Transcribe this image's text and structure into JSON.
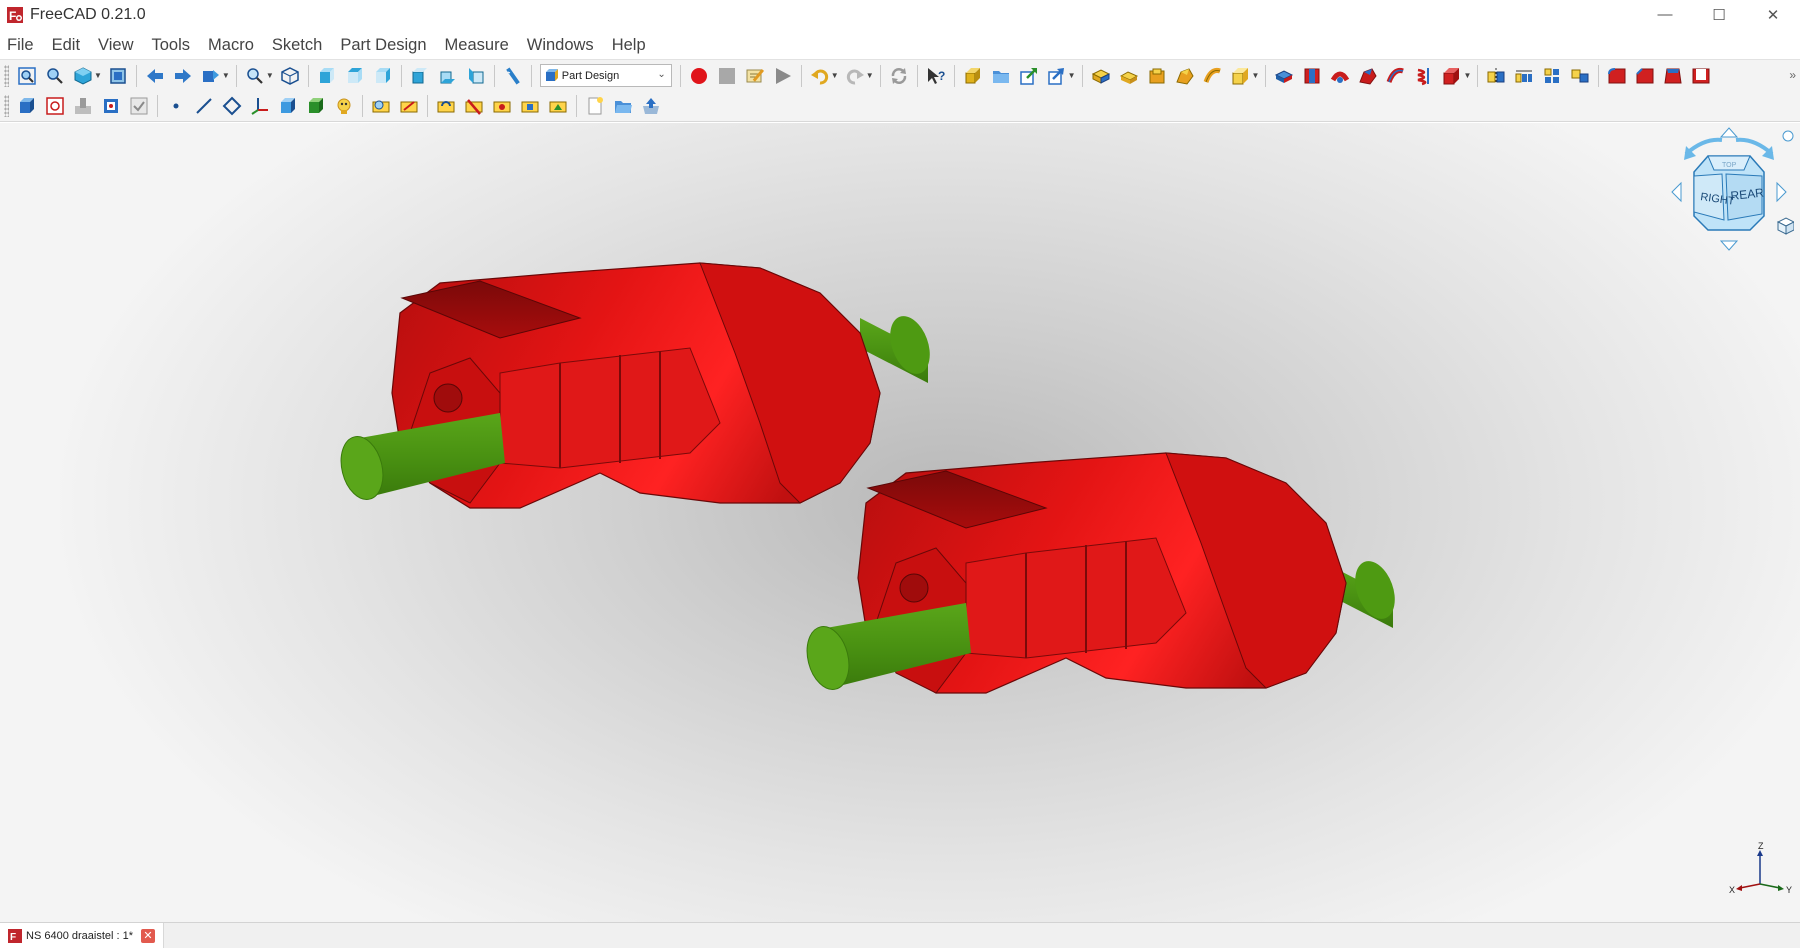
{
  "app": {
    "title": "FreeCAD 0.21.0",
    "logo_icon": "freecad-logo-icon",
    "window_controls": {
      "minimize": "—",
      "maximize": "☐",
      "close": "✕"
    }
  },
  "menu": {
    "items": [
      "File",
      "Edit",
      "View",
      "Tools",
      "Macro",
      "Sketch",
      "Part Design",
      "Measure",
      "Windows",
      "Help"
    ]
  },
  "toolbar": {
    "workbench_selector": {
      "value": "Part Design",
      "icon": "part-design-icon"
    },
    "overflow": "»"
  },
  "viewport": {
    "navcube": {
      "face_right": "RIGHT",
      "face_rear": "REAR",
      "face_top": "TOP"
    },
    "axis": {
      "z": "Z",
      "y": "Y",
      "x": "X"
    },
    "colors": {
      "housing": "#e01010",
      "shaft": "#4e9a12",
      "background": "#c8c8c8"
    }
  },
  "document_tab": {
    "label": "NS 6400 draaistel : 1*",
    "close": "✕"
  }
}
